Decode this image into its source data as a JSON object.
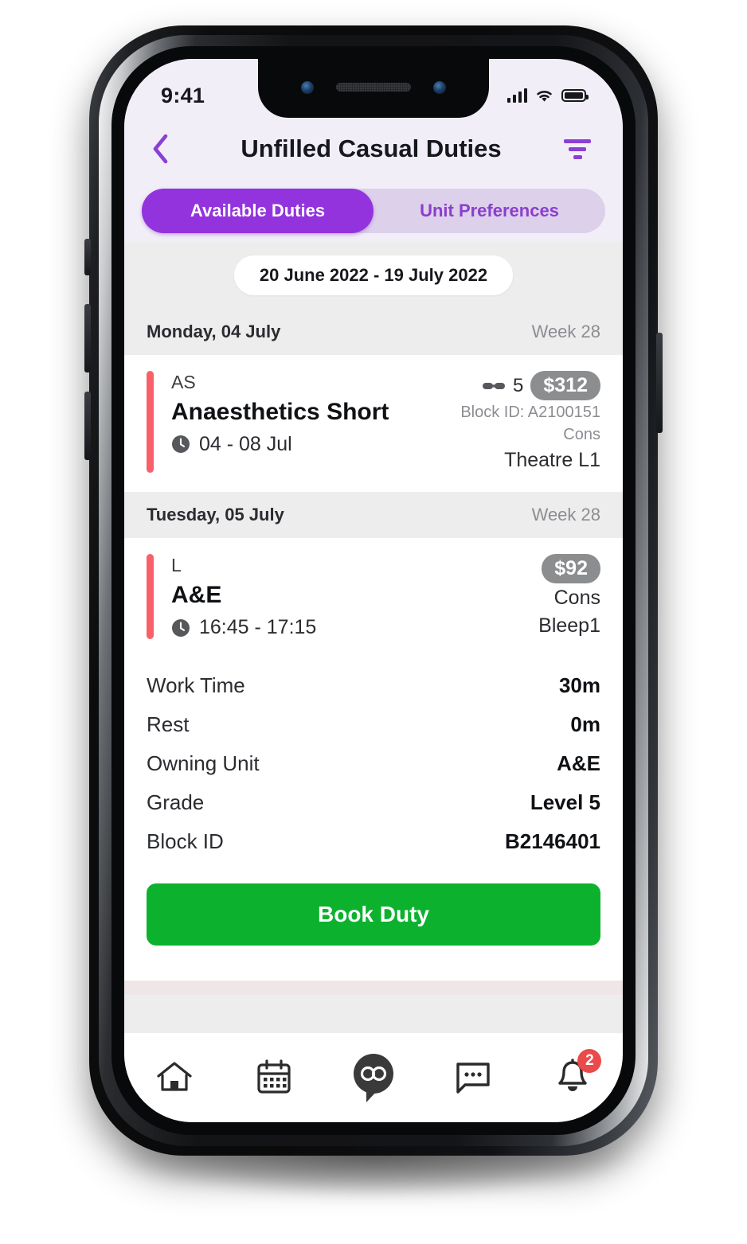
{
  "status_bar": {
    "time": "9:41",
    "signal_icon": "cellular-signal-icon",
    "wifi_icon": "wifi-icon",
    "battery_icon": "battery-full-icon"
  },
  "header": {
    "back_icon": "chevron-left-icon",
    "title": "Unfilled Casual Duties",
    "filter_icon": "filter-icon"
  },
  "tabs": [
    {
      "label": "Available Duties",
      "active": true
    },
    {
      "label": "Unit Preferences",
      "active": false
    }
  ],
  "date_range": "20 June 2022 - 19 July 2022",
  "groups": [
    {
      "day": "Monday, 04 July",
      "week": "Week 28",
      "duty": {
        "code": "AS",
        "name": "Anaesthetics Short",
        "clock_icon": "clock-icon",
        "time": "04 - 08 Jul",
        "link_icon": "link-chain-icon",
        "link_count": "5",
        "price": "$312",
        "block_id": "Block ID: A2100151",
        "grade_short": "Cons",
        "location": "Theatre L1"
      }
    },
    {
      "day": "Tuesday, 05 July",
      "week": "Week 28",
      "duty": {
        "code": "L",
        "name": "A&E",
        "clock_icon": "clock-icon",
        "time": "16:45 - 17:15",
        "link_icon": "",
        "link_count": "",
        "price": "$92",
        "block_id": "",
        "grade_short": "Cons",
        "location": "Bleep1"
      }
    }
  ],
  "details": [
    {
      "label": "Work Time",
      "value": "30m"
    },
    {
      "label": "Rest",
      "value": "0m"
    },
    {
      "label": "Owning Unit",
      "value": "A&E"
    },
    {
      "label": "Grade",
      "value": "Level 5"
    },
    {
      "label": "Block ID",
      "value": "B2146401"
    }
  ],
  "cta": {
    "label": "Book Duty"
  },
  "bottom_nav": [
    {
      "icon": "home-icon",
      "active": false
    },
    {
      "icon": "calendar-icon",
      "active": false
    },
    {
      "icon": "logo-pin-icon",
      "active": true
    },
    {
      "icon": "chat-bubble-icon",
      "active": false
    },
    {
      "icon": "bell-icon",
      "active": false,
      "badge": "2"
    }
  ],
  "colors": {
    "accent_purple": "#9333dd",
    "tab_track": "#ddd0ea",
    "duty_accent_red": "#f9606a",
    "price_pill_gray": "#8b8d8f",
    "cta_green": "#0cb22e",
    "badge_red": "#ea4a4a",
    "header_bg": "#f2eef8",
    "body_bg": "#ededed"
  }
}
